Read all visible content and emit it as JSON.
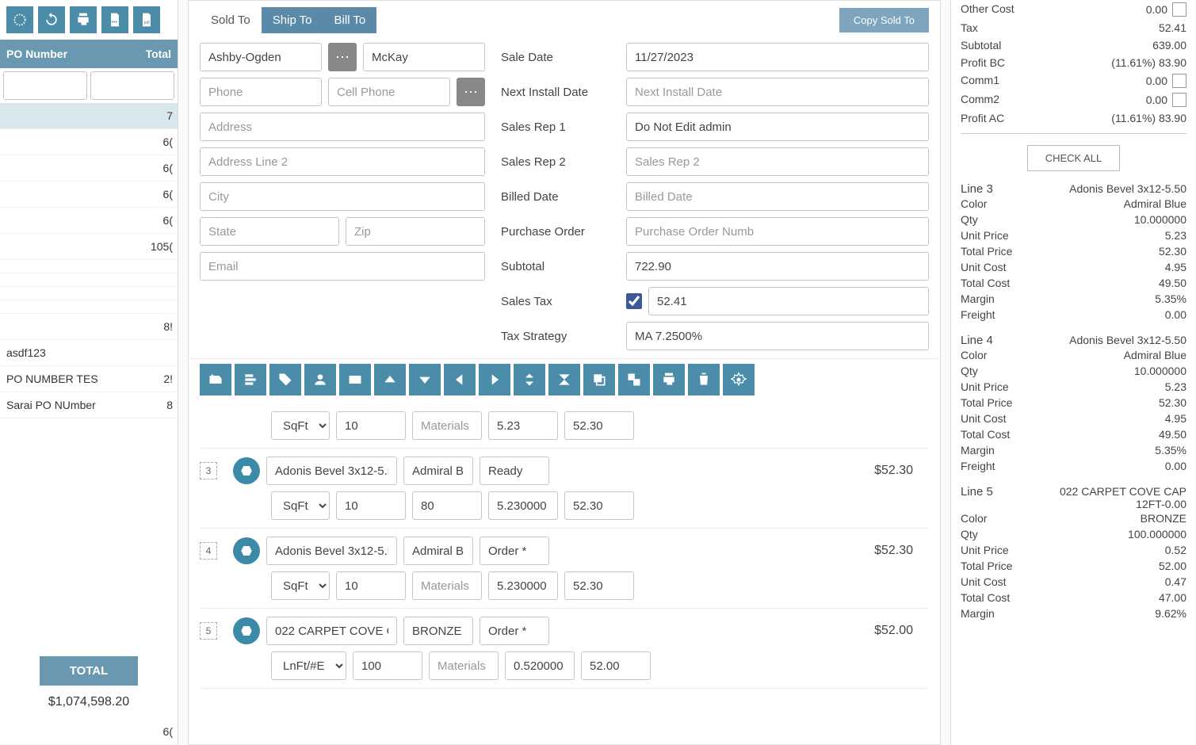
{
  "left": {
    "headers": {
      "po": "PO Number",
      "total": "Total"
    },
    "rows": [
      {
        "po": "",
        "total": "7",
        "hl": true
      },
      {
        "po": "",
        "total": "6("
      },
      {
        "po": "",
        "total": "6("
      },
      {
        "po": "",
        "total": "6("
      },
      {
        "po": "",
        "total": "6("
      },
      {
        "po": "",
        "total": "105("
      },
      {
        "po": "",
        "total": ""
      },
      {
        "po": "",
        "total": ""
      },
      {
        "po": "",
        "total": ""
      },
      {
        "po": "",
        "total": ""
      },
      {
        "po": "",
        "total": "8!"
      },
      {
        "po": "asdf123",
        "total": ""
      },
      {
        "po": "PO NUMBER TES",
        "total": "2!"
      },
      {
        "po": "Sarai PO NUmber",
        "total": "8"
      }
    ],
    "total_label": "TOTAL",
    "total_value": "$1,074,598.20",
    "after_row": "6("
  },
  "tabs": {
    "sold": "Sold To",
    "ship": "Ship To",
    "bill": "Bill To",
    "copy": "Copy Sold To"
  },
  "shipto": {
    "name1": "Ashby-Ogden",
    "name2": "McKay",
    "phone_ph": "Phone",
    "cell_ph": "Cell Phone",
    "addr_ph": "Address",
    "addr2_ph": "Address Line 2",
    "city_ph": "City",
    "state_ph": "State",
    "zip_ph": "Zip",
    "email_ph": "Email"
  },
  "order": {
    "sale_date_l": "Sale Date",
    "sale_date": "11/27/2023",
    "next_install_l": "Next Install Date",
    "next_install_ph": "Next Install Date",
    "rep1_l": "Sales Rep 1",
    "rep1": "Do Not Edit admin",
    "rep2_l": "Sales Rep 2",
    "rep2_ph": "Sales Rep 2",
    "billed_l": "Billed Date",
    "billed_ph": "Billed Date",
    "po_l": "Purchase Order",
    "po_ph": "Purchase Order Numb",
    "subtotal_l": "Subtotal",
    "subtotal": "722.90",
    "tax_l": "Sales Tax",
    "tax": "52.41",
    "strategy_l": "Tax Strategy",
    "strategy": "MA 7.2500%"
  },
  "lines": [
    {
      "num": "",
      "product": "",
      "color": "",
      "status": "",
      "unit": "SqFt",
      "qty": "10",
      "mat_ph": "Materials",
      "uprice": "5.23",
      "ext": "52.30",
      "price": ""
    },
    {
      "num": "3",
      "product": "Adonis Bevel 3x12-5.50",
      "color": "Admiral Blue",
      "status": "Ready",
      "unit": "SqFt",
      "qty": "10",
      "mat": "80",
      "mat_ph": "",
      "uprice": "5.230000",
      "ext": "52.30",
      "price": "$52.30"
    },
    {
      "num": "4",
      "product": "Adonis Bevel 3x12-5.50",
      "color": "Admiral Blue",
      "status": "Order *",
      "unit": "SqFt",
      "qty": "10",
      "mat_ph": "Materials",
      "uprice": "5.230000",
      "ext": "52.30",
      "price": "$52.30"
    },
    {
      "num": "5",
      "product": "022 CARPET COVE CA",
      "color": "BRONZE",
      "status": "Order *",
      "unit": "LnFt/#E",
      "qty": "100",
      "mat_ph": "Materials",
      "uprice": "0.520000",
      "ext": "52.00",
      "price": "$52.00"
    }
  ],
  "summary": {
    "rows": [
      {
        "l": "Other Cost",
        "v": "0.00",
        "chk": true
      },
      {
        "l": "Tax",
        "v": "52.41"
      },
      {
        "l": "Subtotal",
        "v": "639.00"
      },
      {
        "l": "Profit BC",
        "v": "(11.61%)  83.90"
      },
      {
        "l": "Comm1",
        "v": "0.00",
        "chk": true
      },
      {
        "l": "Comm2",
        "v": "0.00",
        "chk": true
      },
      {
        "l": "Profit AC",
        "v": "(11.61%)  83.90"
      }
    ],
    "check_all": "CHECK ALL"
  },
  "details": [
    {
      "line": "Line 3",
      "name": "Adonis Bevel 3x12-5.50",
      "rows": [
        {
          "l": "Color",
          "v": "Admiral Blue"
        },
        {
          "l": "Qty",
          "v": "10.000000"
        },
        {
          "l": "Unit Price",
          "v": "5.23"
        },
        {
          "l": "Total Price",
          "v": "52.30"
        },
        {
          "l": "Unit Cost",
          "v": "4.95"
        },
        {
          "l": "Total Cost",
          "v": "49.50",
          "chk": true
        },
        {
          "l": "Margin",
          "v": "5.35%"
        },
        {
          "l": "Freight",
          "v": "0.00"
        }
      ]
    },
    {
      "line": "Line 4",
      "name": "Adonis Bevel 3x12-5.50",
      "rows": [
        {
          "l": "Color",
          "v": "Admiral Blue"
        },
        {
          "l": "Qty",
          "v": "10.000000"
        },
        {
          "l": "Unit Price",
          "v": "5.23"
        },
        {
          "l": "Total Price",
          "v": "52.30"
        },
        {
          "l": "Unit Cost",
          "v": "4.95"
        },
        {
          "l": "Total Cost",
          "v": "49.50",
          "chk": true
        },
        {
          "l": "Margin",
          "v": "5.35%"
        },
        {
          "l": "Freight",
          "v": "0.00"
        }
      ]
    },
    {
      "line": "Line 5",
      "name": "022 CARPET COVE CAP 12FT-0.00",
      "rows": [
        {
          "l": "Color",
          "v": "BRONZE"
        },
        {
          "l": "Qty",
          "v": "100.000000"
        },
        {
          "l": "Unit Price",
          "v": "0.52"
        },
        {
          "l": "Total Price",
          "v": "52.00"
        },
        {
          "l": "Unit Cost",
          "v": "0.47"
        },
        {
          "l": "Total Cost",
          "v": "47.00",
          "chk": true
        },
        {
          "l": "Margin",
          "v": "9.62%"
        }
      ]
    }
  ]
}
